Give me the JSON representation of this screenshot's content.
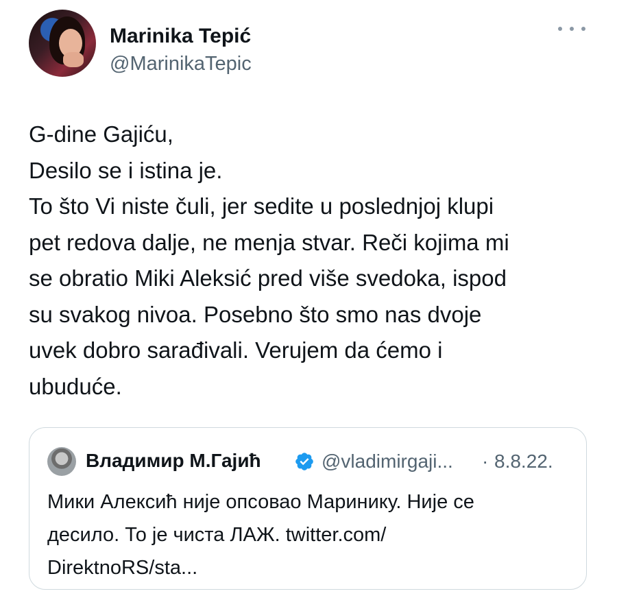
{
  "author": {
    "name": "Marinika Tepić",
    "handle": "@MarinikaTepic"
  },
  "more_icon": "more-dots-icon",
  "tweet_lines": [
    "G-dine Gajiću,",
    "Desilo se i istina je.",
    "To što Vi niste čuli, jer sedite u poslednjoj klupi",
    "pet redova dalje, ne menja stvar. Reči kojima mi",
    "se obratio Miki Aleksić pred više svedoka, ispod",
    "su svakog nivoa. Posebno što smo nas dvoje",
    "uvek dobro sarađivali. Verujem da ćemo i",
    "ubuduće."
  ],
  "quoted": {
    "name": "Владимир М.Гајић",
    "handle": "@vladimirgaji...",
    "separator": "·",
    "date": "8.8.22.",
    "verified_color": "#1d9bf0",
    "lines": [
      "Мики Алексић није опсовао Маринику. Није се",
      "десило. То је чиста ЛАЖ. twitter.com/",
      "DirektnoRS/sta..."
    ]
  }
}
